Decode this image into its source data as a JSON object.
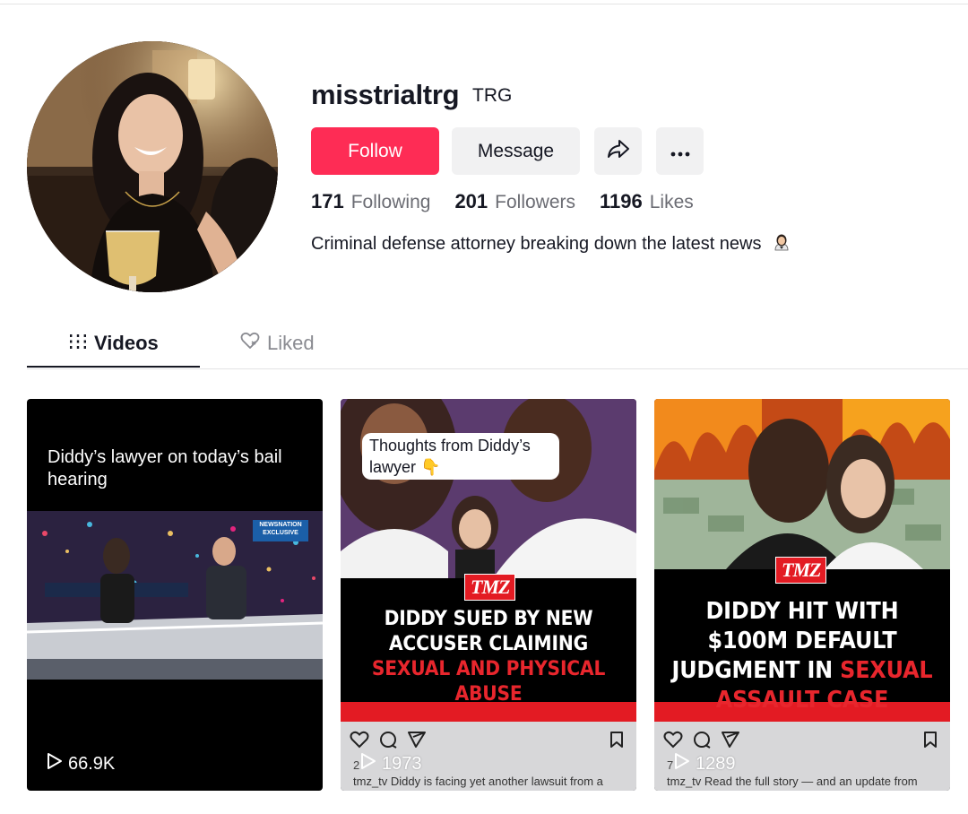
{
  "profile": {
    "username": "misstrialtrg",
    "nickname": "TRG",
    "follow_label": "Follow",
    "message_label": "Message",
    "share_icon": "share-arrow-icon",
    "more_icon": "more-dots-icon",
    "stats": [
      {
        "value": "171",
        "label": "Following"
      },
      {
        "value": "201",
        "label": "Followers"
      },
      {
        "value": "1196",
        "label": "Likes"
      }
    ],
    "bio": "Criminal defense attorney breaking down the latest news",
    "bio_emoji": "woman-judge-emoji"
  },
  "tabs": [
    {
      "label": "Videos",
      "icon": "grid-bars-icon",
      "active": true
    },
    {
      "label": "Liked",
      "icon": "heart-outline-icon",
      "active": false
    }
  ],
  "videos": [
    {
      "caption": "Diddy’s lawyer on today’s bail hearing",
      "badge": "NEWSNATION EXCLUSIVE",
      "views": "66.9K"
    },
    {
      "bubble": "Thoughts from Diddy’s lawyer 👇",
      "logo": "TMZ",
      "headline_white": "DIDDY SUED BY NEW ACCUSER CLAIMING",
      "headline_red": "SEXUAL AND PHYSICAL ABUSE",
      "ig_date": "2",
      "ig_caption": "tmz_tv Diddy is facing yet another lawsuit from a",
      "views": "1973"
    },
    {
      "logo": "TMZ",
      "headline_white": "DIDDY HIT WITH $100M DEFAULT JUDGMENT IN",
      "headline_red": "SEXUAL ASSAULT CASE",
      "ig_date": "7",
      "ig_caption": "tmz_tv Read the full story — and an update from",
      "views": "1289"
    }
  ],
  "colors": {
    "accent": "#fe2c55",
    "text": "#161823",
    "muted": "#6b6c73",
    "button_bg": "#f1f1f2",
    "tmz_red": "#e31b23"
  }
}
